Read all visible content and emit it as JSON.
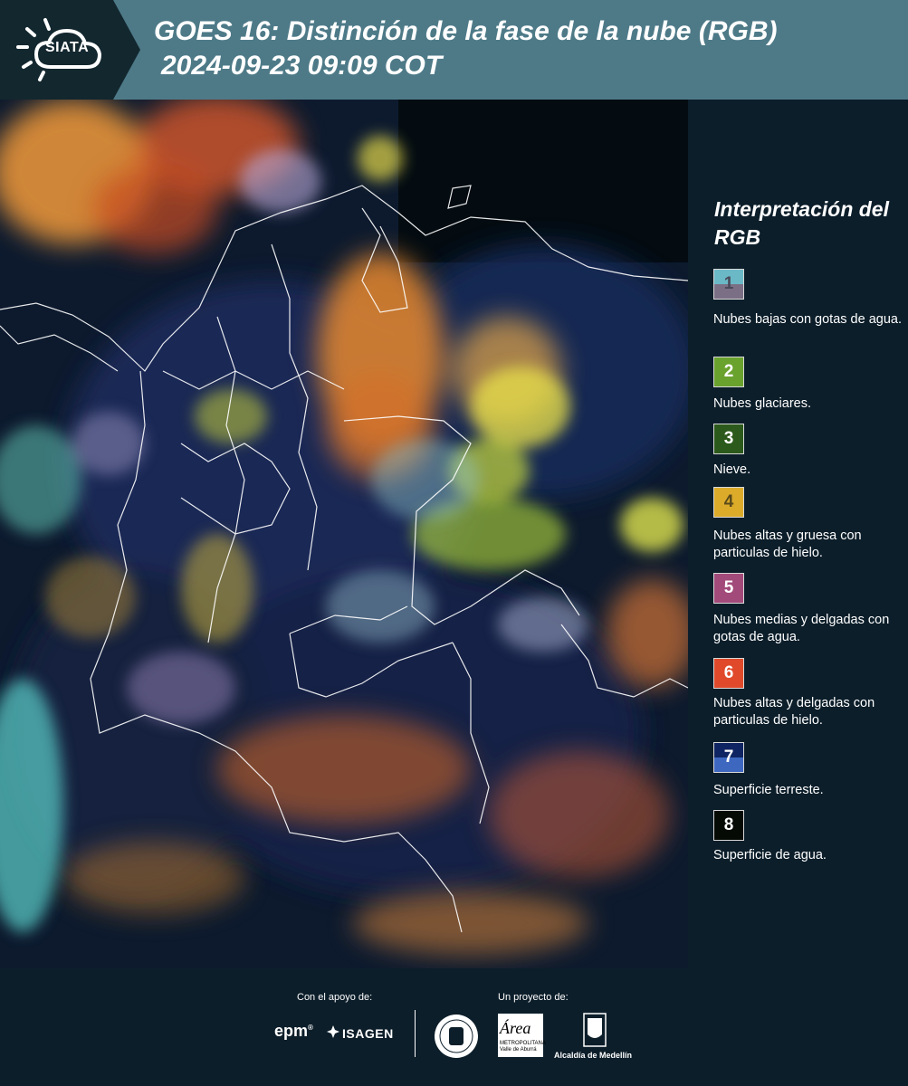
{
  "header": {
    "logo_text": "SIATA",
    "title": "GOES 16: Distinción de la fase de la nube (RGB)",
    "subtitle": "2024-09-23 09:09 COT"
  },
  "map": {
    "description_icon": "satellite-rgb-image"
  },
  "legend": {
    "title": "Interpretación del RGB",
    "items": [
      {
        "number": "1",
        "label": "Nubes bajas con gotas de agua.",
        "color_top": "#6bb8c6",
        "color_bottom": "#7b6f86"
      },
      {
        "number": "2",
        "label": "Nubes glaciares.",
        "color": "#6aa22e"
      },
      {
        "number": "3",
        "label": "Nieve.",
        "color": "#2c5a1c"
      },
      {
        "number": "4",
        "label": "Nubes altas y gruesa con particulas de hielo.",
        "color": "#dcab2a"
      },
      {
        "number": "5",
        "label": "Nubes medias y delgadas con gotas de agua.",
        "color": "#a24a7a"
      },
      {
        "number": "6",
        "label": "Nubes altas y delgadas con particulas de hielo.",
        "color": "#e04a2a"
      },
      {
        "number": "7",
        "label": "Superficie terreste.",
        "color_top": "#0f2462",
        "color_bottom": "#3e68c0"
      },
      {
        "number": "8",
        "label": "Superficie de agua.",
        "color": "#050a05"
      }
    ]
  },
  "footer": {
    "support_label": "Con el apoyo de:",
    "project_label": "Un proyecto de:",
    "epm": "epm",
    "isagen": "ISAGEN",
    "area_text": "Área",
    "area_sub": "METROPOLITANA Valle de Aburrá",
    "alcaldia": "Alcaldía de Medellín"
  }
}
